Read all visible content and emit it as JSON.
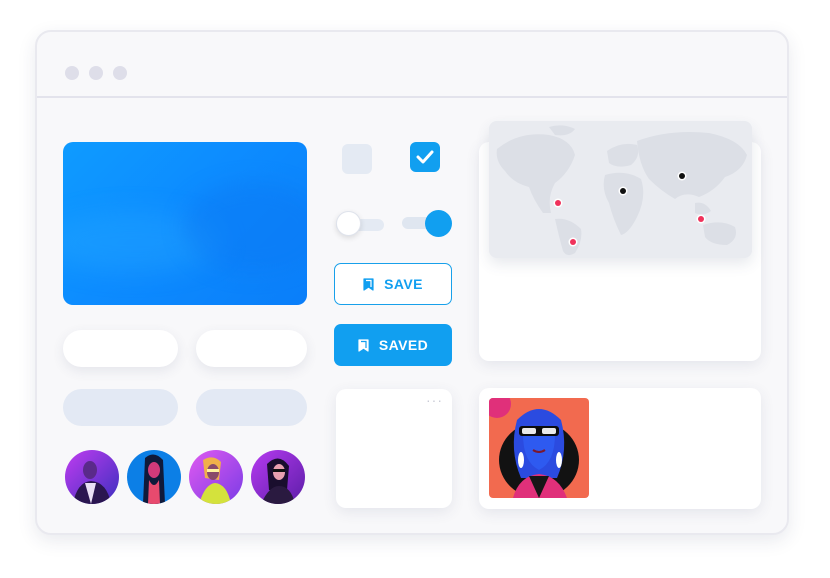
{
  "window": {
    "controls": [
      "window-dot",
      "window-dot",
      "window-dot"
    ]
  },
  "controls": {
    "checkbox_unchecked": {
      "checked": false
    },
    "checkbox_checked": {
      "checked": true,
      "icon": "check-icon"
    },
    "toggle_off": {
      "on": false
    },
    "toggle_on": {
      "on": true
    }
  },
  "buttons": {
    "save_label": "SAVE",
    "saved_label": "SAVED",
    "icon": "bookmark-icon"
  },
  "small_card": {
    "menu_icon": "more-horizontal-icon",
    "menu_glyph": "···"
  },
  "map": {
    "markers": [
      {
        "kind": "pink"
      },
      {
        "kind": "pink"
      },
      {
        "kind": "black"
      },
      {
        "kind": "black"
      },
      {
        "kind": "pink"
      }
    ]
  },
  "colors": {
    "accent": "#119ff0",
    "hero": "#0d8cff",
    "marker_pink": "#f0325b",
    "marker_black": "#111111",
    "avatar_bg": [
      "#8a3ee0",
      "#0c7fe6",
      "#b84df0",
      "#9c2fd3"
    ]
  },
  "avatars": [
    {
      "name": "avatar-1"
    },
    {
      "name": "avatar-2"
    },
    {
      "name": "avatar-3"
    },
    {
      "name": "avatar-4"
    }
  ]
}
